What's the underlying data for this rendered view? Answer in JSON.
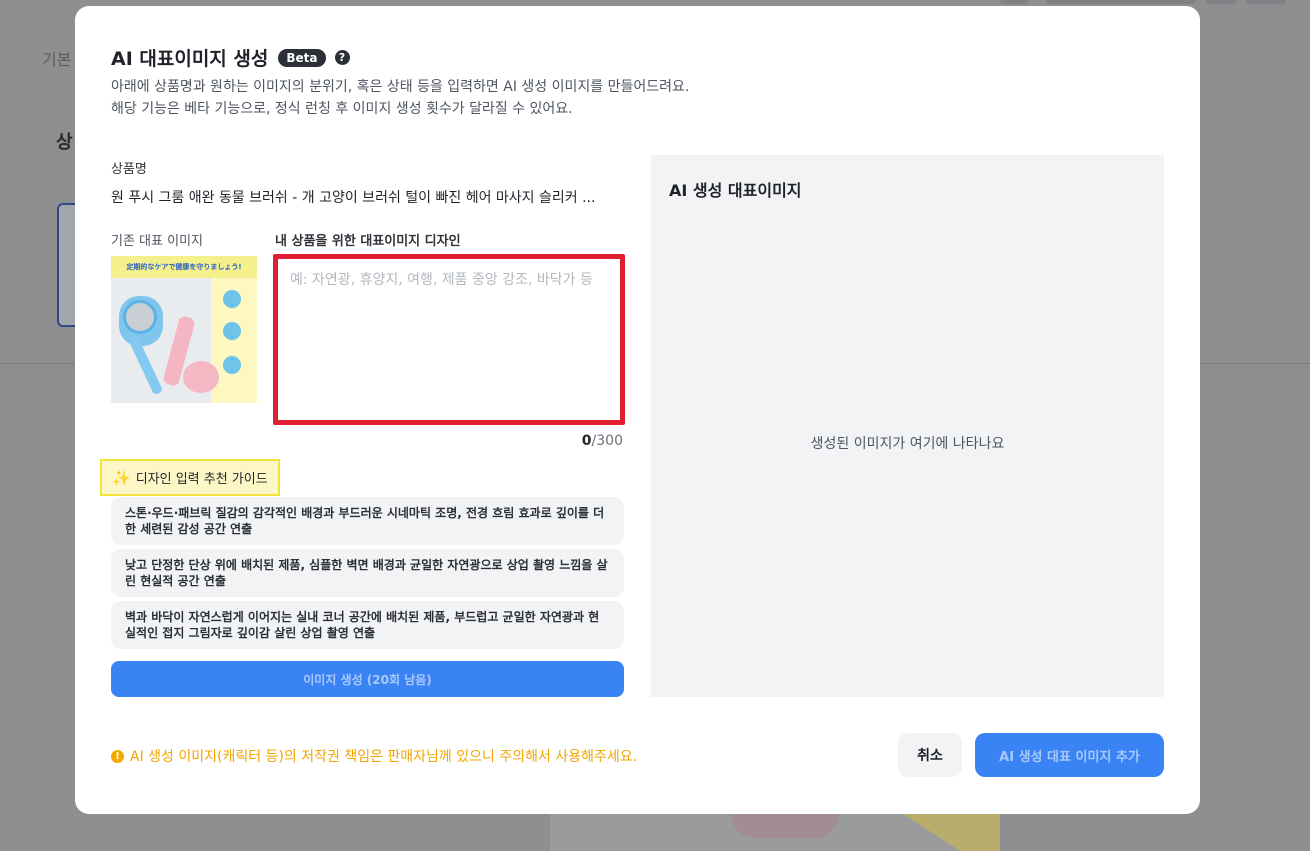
{
  "background": {
    "tab_label": "기본",
    "heading": "상"
  },
  "modal": {
    "title": "AI 대표이미지 생성",
    "beta_badge": "Beta",
    "help_icon": "?",
    "description_line1": "아래에 상품명과 원하는 이미지의 분위기, 혹은 상태 등을 입력하면 AI 생성 이미지를 만들어드려요.",
    "description_line2": "해당 기능은 베타 기능으로, 정식 런칭 후 이미지 생성 횟수가 달라질 수 있어요."
  },
  "form": {
    "product_label": "상품명",
    "product_name": "원 푸시 그룸 애완 동물 브러쉬 - 개 고양이 브러쉬 털이 빠진 헤어 마사지 슬리커 ...",
    "existing_image_label": "기존 대표 이미지",
    "existing_image_banner": "定期的なケアで健康を守りましょう!",
    "design_label": "내 상품을 위한 대표이미지 디자인",
    "design_placeholder": "예: 자연광, 휴양지, 여행, 제품 중앙 강조, 바닥가 등",
    "design_value": "",
    "counter_current": "0",
    "counter_max": "/300"
  },
  "guide": {
    "label": "디자인 입력 추천 가이드",
    "icon": "sparkle-icon",
    "suggestions": [
      "스톤·우드·패브릭 질감의 감각적인 배경과 부드러운 시네마틱 조명, 전경 흐림 효과로 깊이를 더한 세련된 감성 공간 연출",
      "낮고 단정한 단상 위에 배치된 제품, 심플한 벽면 배경과 균일한 자연광으로 상업 촬영 느낌을 살린 현실적 공간 연출",
      "벽과 바닥이 자연스럽게 이어지는 실내 코너 공간에 배치된 제품, 부드럽고 균일한 자연광과 현실적인 접지 그림자로 깊이감 살린 상업 촬영 연출"
    ]
  },
  "generate_button": "이미지 생성 (20회 남음)",
  "result_panel": {
    "title": "AI 생성 대표이미지",
    "empty_text": "생성된 이미지가 여기에 나타나요"
  },
  "footer": {
    "warning": "AI 생성 이미지(캐릭터 등)의 저작권 책임은 판매자님께 있으니 주의해서 사용해주세요.",
    "warning_icon": "!",
    "cancel_button": "취소",
    "add_button": "AI 생성 대표 이미지 추가"
  },
  "colors": {
    "accent": "#3a83f5",
    "highlight_border": "#e02030",
    "warning": "#f2a500",
    "guide_highlight": "#fdf7c7"
  }
}
